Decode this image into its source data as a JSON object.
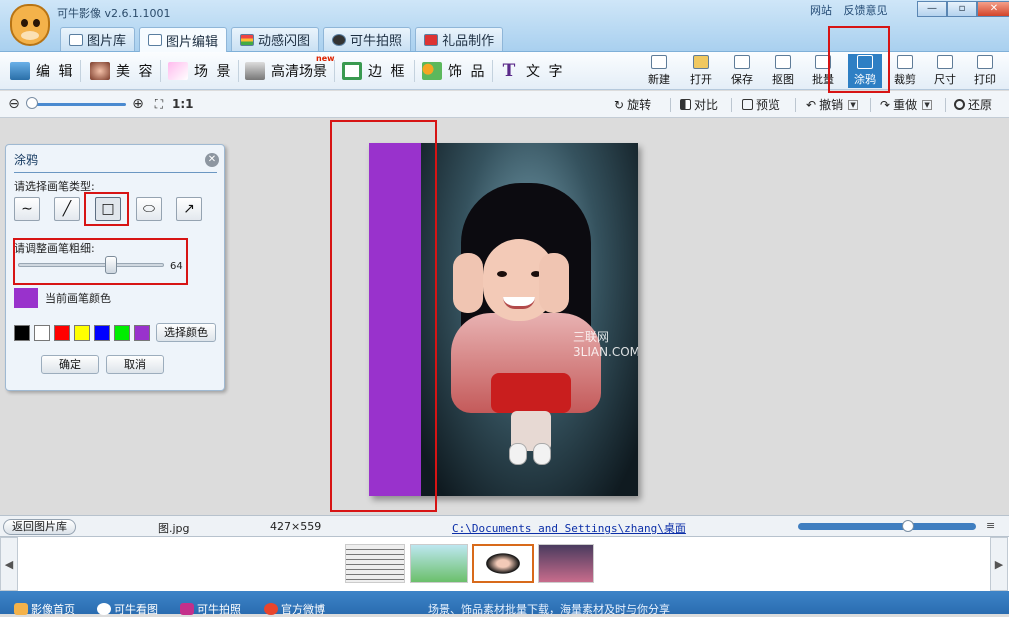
{
  "app": {
    "title": "可牛影像 v2.6.1.1001",
    "top_links": [
      "网站",
      "反馈意见"
    ],
    "window_controls": [
      "minimize-icon",
      "maximize-icon",
      "close-icon"
    ],
    "tabs": [
      {
        "label": "图片库",
        "active": false
      },
      {
        "label": "图片编辑",
        "active": true
      },
      {
        "label": "动感闪图",
        "active": false
      },
      {
        "label": "可牛拍照",
        "active": false
      },
      {
        "label": "礼品制作",
        "active": false
      }
    ]
  },
  "toolbar": {
    "tools": [
      "编 辑",
      "美 容",
      "场 景",
      "高清场景",
      "边 框",
      "饰 品",
      "文 字"
    ],
    "new_badge": "new",
    "actions": [
      {
        "label": "新建",
        "active": false
      },
      {
        "label": "打开",
        "active": false
      },
      {
        "label": "保存",
        "active": false
      },
      {
        "label": "抠图",
        "active": false
      },
      {
        "label": "批量",
        "active": false
      },
      {
        "label": "涂鸦",
        "active": true
      },
      {
        "label": "裁剪",
        "active": false
      },
      {
        "label": "尺寸",
        "active": false
      },
      {
        "label": "打印",
        "active": false
      }
    ]
  },
  "zoombar": {
    "ratio_label": "1:1",
    "zoom_level": 0.04,
    "actions": [
      "旋转",
      "对比",
      "预览",
      "撤销",
      "重做",
      "还原"
    ]
  },
  "graffiti_panel": {
    "title": "涂鸦",
    "brush_type_label": "请选择画笔类型:",
    "brushes": [
      {
        "icon": "freehand-brush-icon",
        "glyph": "∼",
        "selected": false
      },
      {
        "icon": "line-brush-icon",
        "glyph": "╱",
        "selected": false
      },
      {
        "icon": "rectangle-brush-icon",
        "glyph": "□",
        "selected": true
      },
      {
        "icon": "ellipse-brush-icon",
        "glyph": "⬭",
        "selected": false
      },
      {
        "icon": "arrow-brush-icon",
        "glyph": "↗",
        "selected": false
      }
    ],
    "thickness_label": "请调整画笔粗细:",
    "thickness_value": "64",
    "thickness_fraction": 0.64,
    "current_color_label": "当前画笔颜色",
    "current_color": "#9932cc",
    "palette": [
      "#000000",
      "#ffffff",
      "#ff0000",
      "#ffff00",
      "#0000ff",
      "#00ee00",
      "#9932cc"
    ],
    "choose_color_label": "选择颜色",
    "ok_label": "确定",
    "cancel_label": "取消"
  },
  "canvas": {
    "stroke_color": "#9932cc",
    "watermark": "三联网 3LIAN.COM"
  },
  "statusbar": {
    "back_label": "返回图片库",
    "file_name": "图.jpg",
    "dimensions": "427×559",
    "path": "C:\\Documents and Settings\\zhang\\桌面",
    "strip_zoom": 0.62
  },
  "footer": {
    "links": [
      "影像首页",
      "可牛看图",
      "可牛拍照",
      "官方微博"
    ],
    "notice": "场景、饰品素材批量下载，海量素材及时与你分享"
  },
  "highlight_color": "#d71414"
}
